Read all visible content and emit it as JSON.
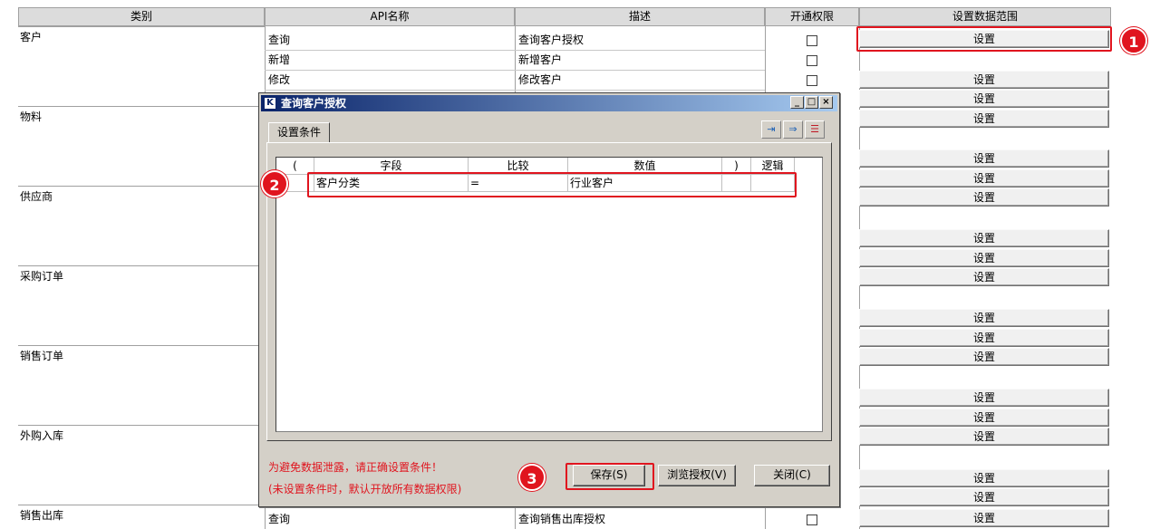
{
  "headers": {
    "category": "类别",
    "api_name": "API名称",
    "description": "描述",
    "permission": "开通权限",
    "data_scope": "设置数据范围"
  },
  "categories": [
    "客户",
    "物料",
    "供应商",
    "采购订单",
    "销售订单",
    "外购入库",
    "销售出库"
  ],
  "visible_rows": [
    {
      "api": "查询",
      "desc": "查询客户授权"
    },
    {
      "api": "新增",
      "desc": "新增客户"
    },
    {
      "api": "修改",
      "desc": "修改客户"
    },
    {
      "api": "查询",
      "desc": "查询销售出库授权"
    }
  ],
  "set_button_label": "设置",
  "dialog": {
    "title": "查询客户授权",
    "tab": "设置条件",
    "columns": {
      "open": "(",
      "field": "字段",
      "compare": "比较",
      "value": "数值",
      "close": ")",
      "logic": "逻辑"
    },
    "condition": {
      "open": "",
      "field": "客户分类",
      "compare": "=",
      "value": "行业客户",
      "close": "",
      "logic": ""
    },
    "warning_line1": "为避免数据泄露，请正确设置条件！",
    "warning_line2": "(未设置条件时，默认开放所有数据权限)",
    "buttons": {
      "save": "保存(S)",
      "browse": "浏览授权(V)",
      "close": "关闭(C)"
    },
    "window_controls": {
      "minimize": "_",
      "maximize": "□",
      "close": "×"
    }
  },
  "callouts": [
    "1",
    "2",
    "3"
  ],
  "colors": {
    "callout": "#e0141e",
    "titlebar": "#0a246a",
    "dialog_bg": "#d4d0c8"
  }
}
